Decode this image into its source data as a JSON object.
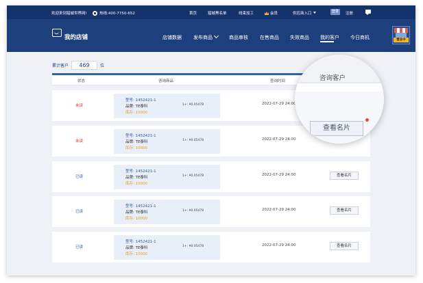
{
  "topbar": {
    "welcome": "欢迎来到猎城世界网!",
    "hotline": "热线:400-7750-652",
    "links": [
      "首页",
      "猎城黑名单",
      "线束加工",
      "会员",
      "供应商入口"
    ],
    "login": "登录",
    "register": "注册"
  },
  "header": {
    "store_title": "我的店铺",
    "nav": [
      "店铺数据",
      "发布商品",
      "商品审核",
      "在售商品",
      "失效商品",
      "我的客户",
      "今日商机"
    ],
    "store_status": "营业中"
  },
  "counter": {
    "label": "累计客户",
    "value": "469",
    "unit": "位"
  },
  "table": {
    "headers": [
      "状态",
      "咨询商品",
      "查询时间"
    ],
    "rows": [
      {
        "status": "未读",
        "model": "型号: 1452421-1",
        "brand": "品牌: TE泰科",
        "stock": "库存: 10000",
        "price": "1+: ¥0.05478",
        "time": "2022-07-29  24:00",
        "button": ""
      },
      {
        "status": "未读",
        "model": "型号: 1452421-1",
        "brand": "品牌: TE泰科",
        "stock": "库存: 10000",
        "price": "1+: ¥0.05478",
        "time": "2022-07-29  24:00",
        "button": ""
      },
      {
        "status": "已读",
        "model": "型号: 1452421-1",
        "brand": "品牌: TE泰科",
        "stock": "库存: 10000",
        "price": "1+: ¥0.05478",
        "time": "2022-07-29  24:00",
        "button": "查看名片"
      },
      {
        "status": "已读",
        "model": "型号: 1452421-1",
        "brand": "品牌: TE泰科",
        "stock": "库存: 10000",
        "price": "1+: ¥0.05478",
        "time": "2022-07-29  24:00",
        "button": "查看名片"
      },
      {
        "status": "已读",
        "model": "型号: 1452421-1",
        "brand": "品牌: TE泰科",
        "stock": "库存: 10000",
        "price": "1+: ¥0.05478",
        "time": "2022-07-29  24:00",
        "button": "查看名片"
      }
    ]
  },
  "magnifier": {
    "header": "咨询客户",
    "button": "查看名片"
  },
  "colors": {
    "nav_bg": "#1d3f7c",
    "topbar_bg": "#14336d",
    "unread": "#e1312a",
    "read": "#2b56a3",
    "stock": "#e89a1d"
  }
}
